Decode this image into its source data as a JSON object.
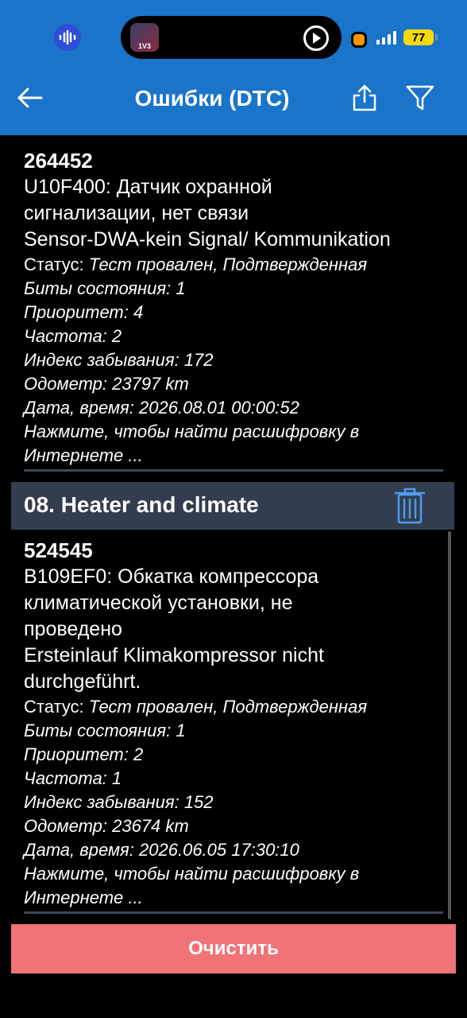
{
  "status_bar": {
    "island_thumb_text": "1V3",
    "battery": "77",
    "icons": [
      "voice-recorder-icon",
      "play-icon",
      "recording-dot-icon",
      "signal-icon",
      "battery-icon"
    ]
  },
  "app_bar": {
    "title": "Ошибки (DTC)",
    "icons": [
      "back-arrow-icon",
      "share-icon",
      "filter-icon"
    ]
  },
  "entries": [
    {
      "code": "264452",
      "description": "U10F400: Датчик охранной\nсигнализации, нет связи\nSensor-DWA-kein Signal/ Kommunikation",
      "status_label": "Статус: ",
      "status_value": "Тест провален, Подтвержденная",
      "bits": "Биты состояния: 1",
      "priority": "Приоритет: 4",
      "frequency": "Частота: 2",
      "forget_index": "Индекс забывания: 172",
      "odometer": "Одометр: 23797 km",
      "datetime": "Дата, время: 2026.08.01 00:00:52",
      "search_hint": "Нажмите, чтобы найти расшифровку в\nИнтернете ..."
    },
    {
      "code": "524545",
      "description": "B109EF0: Обкатка компрессора\nклиматической установки, не\nпроведено\nErsteinlauf Klimakompressor nicht\ndurchgeführt.",
      "status_label": "Статус: ",
      "status_value": "Тест провален, Подтвержденная",
      "bits": "Биты состояния: 1",
      "priority": "Приоритет: 2",
      "frequency": "Частота: 1",
      "forget_index": "Индекс забывания: 152",
      "odometer": "Одометр: 23674 km",
      "datetime": "Дата, время: 2026.06.05 17:30:10",
      "search_hint": "Нажмите, чтобы найти расшифровку в\nИнтернете ..."
    }
  ],
  "section": {
    "title": "08. Heater and climate",
    "icon": "trash-icon"
  },
  "footer": {
    "clear_label": "Очистить"
  },
  "colors": {
    "header": "#1a74c9",
    "section": "#323e4f",
    "clear_button": "#f07377",
    "background": "#000000"
  }
}
